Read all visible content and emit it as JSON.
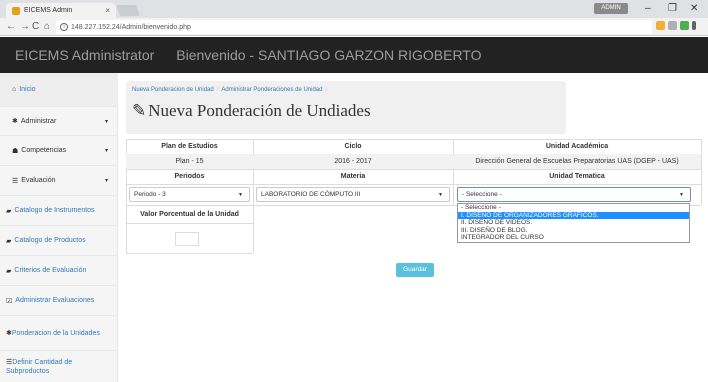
{
  "browser": {
    "tab_title": "EICEMS Admin",
    "tab_close": "×",
    "url": "148.227.152.24/Admin/bienvenido.php",
    "user_badge": "ADMIN",
    "win_min": "–",
    "win_max": "❐",
    "win_close": "✕"
  },
  "header": {
    "brand": "EICEMS Administrator",
    "welcome": "Bienvenido - SANTIAGO GARZON RIGOBERTO"
  },
  "sidebar": {
    "items": [
      {
        "label": "Inicio",
        "icon": "home-icon"
      },
      {
        "label": "Administrar",
        "icon": "gear-icon"
      },
      {
        "label": "Competencias",
        "icon": "users-icon"
      },
      {
        "label": "Evaluación",
        "icon": "list-icon"
      },
      {
        "label": "Catalogo de Instrumentos",
        "icon": "book-icon"
      },
      {
        "label": "Catalogo de Productos",
        "icon": "book-icon"
      },
      {
        "label": "Criterios de Evaluación",
        "icon": "book-icon"
      },
      {
        "label": "Administrar Evaluaciones",
        "icon": "edit-icon"
      },
      {
        "label": "Ponderacion de la Unidades",
        "icon": "gear-icon"
      },
      {
        "label": "Definir Cantidad de Subproductos",
        "icon": "list-icon"
      }
    ]
  },
  "breadcrumb": {
    "item1": "Nueva Ponderacion de Unidad",
    "item2": "Administrar Ponderaciones de Unidad",
    "sep": "/"
  },
  "page": {
    "title": "Nueva Ponderación de Undiades"
  },
  "table": {
    "headers_row1": [
      "Plan de Estudios",
      "Ciclo",
      "Unidad Académica"
    ],
    "values_row1": [
      "Plan - 15",
      "2016 - 2017",
      "Dirección General de Escuelas Preparatorias UAS (DGEP - UAS)"
    ],
    "headers_row2": [
      "Periodos",
      "Materia",
      "Unidad Tematica"
    ],
    "periodo_selected": "Periodo - 3",
    "materia_selected": "LABORATORIO DE CÓMPUTO III",
    "unidad_selected": "- Seleccione -",
    "valor_label": "Valor Porcentual de la Unidad"
  },
  "dropdown": {
    "options": [
      "- Seleccione -",
      "I. DISEÑO DE ORGANIZADORES GRAFICOS.",
      "II. DISEÑO DE VIDEOS.",
      "III. DISEÑO DE BLOG.",
      "INTEGRADOR DEL CURSO"
    ]
  },
  "buttons": {
    "save": "Guardar"
  },
  "colors": {
    "header_bg": "#222222",
    "link": "#337ab7",
    "save_btn": "#5bc0de",
    "highlight": "#1e90ff"
  }
}
